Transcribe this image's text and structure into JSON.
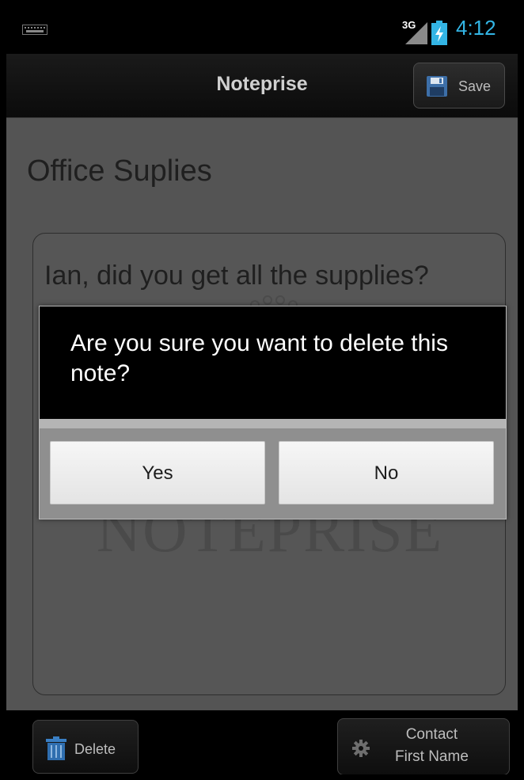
{
  "status_bar": {
    "network": "3G",
    "time": "4:12",
    "accent_color": "#33b5e5"
  },
  "action_bar": {
    "title": "Noteprise",
    "save_label": "Save"
  },
  "note": {
    "title": "Office Suplies",
    "body": "Ian, did you get all the supplies?",
    "watermark": "NOTEPRISE"
  },
  "dialog": {
    "message": "Are you sure you want to delete this note?",
    "yes_label": "Yes",
    "no_label": "No"
  },
  "bottom_bar": {
    "delete_label": "Delete",
    "contact_line1": "Contact",
    "contact_line2": "First Name"
  },
  "icons": [
    "keyboard-icon",
    "signal-icon",
    "battery-icon",
    "save-icon",
    "trash-icon",
    "gear-icon"
  ]
}
